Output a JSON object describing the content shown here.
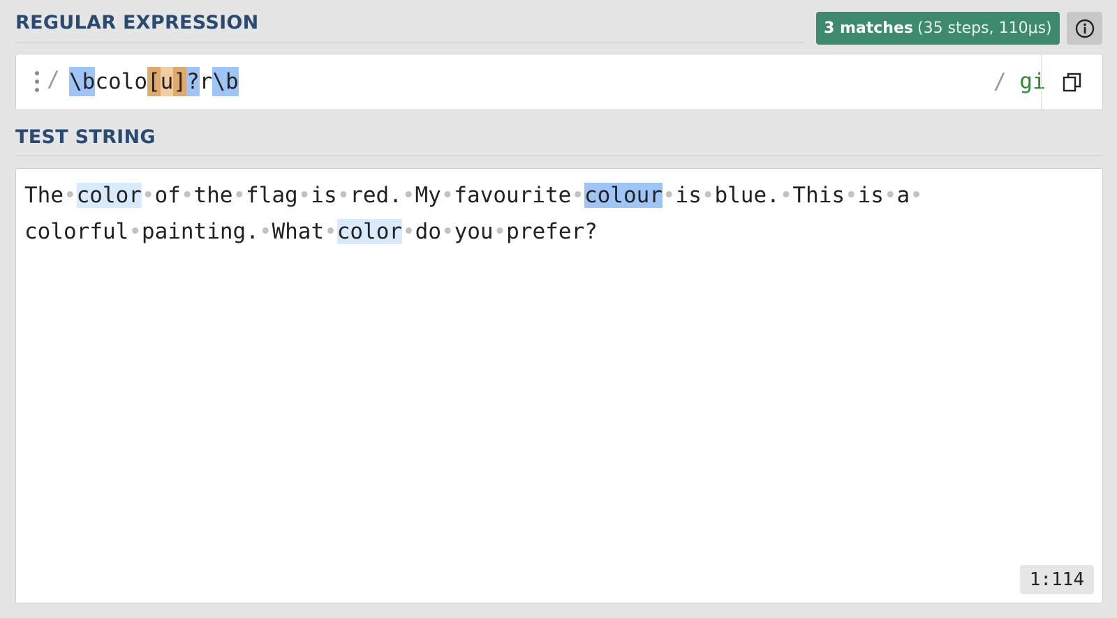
{
  "regex_section": {
    "title": "REGULAR EXPRESSION",
    "match_badge": {
      "count": "3 matches",
      "details": "(35 steps, 110μs)"
    },
    "info_icon": "info-circle-icon",
    "open_delimiter": "/",
    "tokens": [
      {
        "text": "\\b",
        "kind": "anchor"
      },
      {
        "text": "colo",
        "kind": "lit"
      },
      {
        "text": "[",
        "kind": "set-bracket"
      },
      {
        "text": "u",
        "kind": "set-body"
      },
      {
        "text": "]",
        "kind": "set-bracket"
      },
      {
        "text": "?",
        "kind": "quant"
      },
      {
        "text": "r",
        "kind": "lit"
      },
      {
        "text": "\\b",
        "kind": "anchor"
      }
    ],
    "close_delimiter": "/ ",
    "flags": "gi",
    "copy_icon": "copy-icon",
    "token_colors": {
      "anchor": "#9fc5f8",
      "set-bracket": "#e0a96d",
      "set-body": "#f1cca0",
      "quant": "#9fc5f8"
    }
  },
  "test_section": {
    "title": "TEST STRING",
    "lines": [
      [
        {
          "t": "The"
        },
        {
          "ws": true
        },
        {
          "t": "color",
          "m": "light"
        },
        {
          "ws": true
        },
        {
          "t": "of"
        },
        {
          "ws": true
        },
        {
          "t": "the"
        },
        {
          "ws": true
        },
        {
          "t": "flag"
        },
        {
          "ws": true
        },
        {
          "t": "is"
        },
        {
          "ws": true
        },
        {
          "t": "red."
        },
        {
          "ws": true
        },
        {
          "t": "My"
        },
        {
          "ws": true
        },
        {
          "t": "favourite"
        },
        {
          "ws": true
        },
        {
          "t": "colour",
          "m": "strong"
        },
        {
          "ws": true
        },
        {
          "t": "is"
        },
        {
          "ws": true
        },
        {
          "t": "blue."
        },
        {
          "ws": true
        },
        {
          "t": "This"
        },
        {
          "ws": true
        },
        {
          "t": "is"
        },
        {
          "ws": true
        },
        {
          "t": "a"
        },
        {
          "ws": true
        }
      ],
      [
        {
          "t": "colorful"
        },
        {
          "ws": true
        },
        {
          "t": "painting."
        },
        {
          "ws": true
        },
        {
          "t": "What"
        },
        {
          "ws": true
        },
        {
          "t": "color",
          "m": "light"
        },
        {
          "ws": true
        },
        {
          "t": "do"
        },
        {
          "ws": true
        },
        {
          "t": "you"
        },
        {
          "ws": true
        },
        {
          "t": "prefer?"
        }
      ]
    ],
    "cursor_position": "1:114",
    "match_colors": {
      "light": "#d9eafd",
      "strong": "#9fc5f8"
    },
    "whitespace_marker_icon": "space-dot-icon"
  }
}
